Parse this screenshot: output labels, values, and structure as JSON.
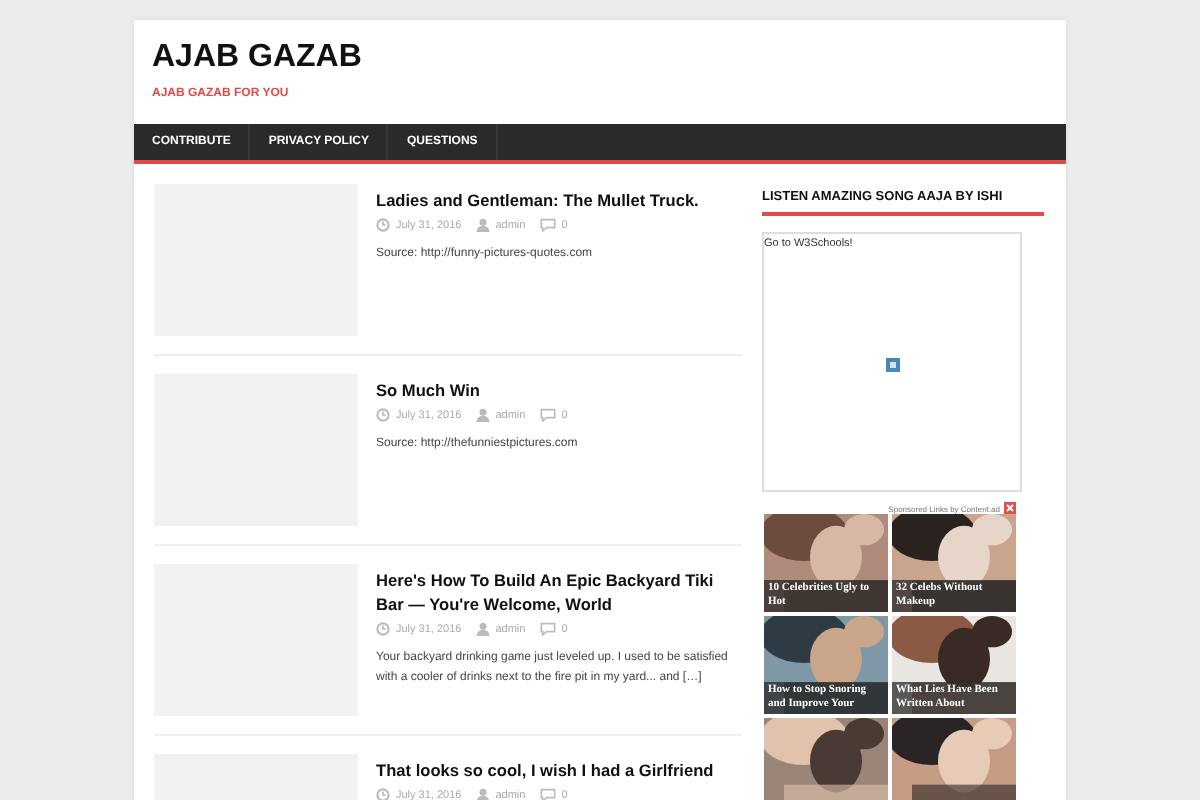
{
  "site": {
    "title": "AJAB GAZAB",
    "tagline": "AJAB GAZAB FOR YOU"
  },
  "nav": [
    {
      "label": "CONTRIBUTE"
    },
    {
      "label": "PRIVACY POLICY"
    },
    {
      "label": "QUESTIONS"
    }
  ],
  "posts": [
    {
      "title": "Ladies and Gentleman: The Mullet Truck.",
      "date": "July 31, 2016",
      "author": "admin",
      "comments": "0",
      "excerpt": "Source: http://funny-pictures-quotes.com"
    },
    {
      "title": "So Much Win",
      "date": "July 31, 2016",
      "author": "admin",
      "comments": "0",
      "excerpt": "Source: http://thefunniestpictures.com"
    },
    {
      "title": "Here's How To Build An Epic Backyard Tiki Bar — You're Welcome, World",
      "date": "July 31, 2016",
      "author": "admin",
      "comments": "0",
      "excerpt": "Your backyard drinking game just leveled up. I used to be satisfied with a cooler of drinks next to the fire pit in my yard... and […]"
    },
    {
      "title": "That looks so cool, I wish I had a Girlfriend",
      "date": "July 31, 2016",
      "author": "admin",
      "comments": "0"
    }
  ],
  "sidebar": {
    "widget_title": "LISTEN AMAZING SONG AAJA BY ISHI",
    "frame_text": "Go to W3Schools!",
    "sponsored": "Sponsored Links by Content.ad",
    "ads": [
      {
        "kind": "captioned",
        "caption": "10 Celebrities Ugly to Hot"
      },
      {
        "kind": "captioned",
        "caption": "32 Celebs Without Makeup"
      },
      {
        "kind": "captioned",
        "caption": "How to Stop Snoring and Improve Your"
      },
      {
        "kind": "captioned",
        "caption": "What Lies Have Been Written About"
      },
      {
        "kind": "picture"
      },
      {
        "kind": "picture"
      }
    ]
  }
}
